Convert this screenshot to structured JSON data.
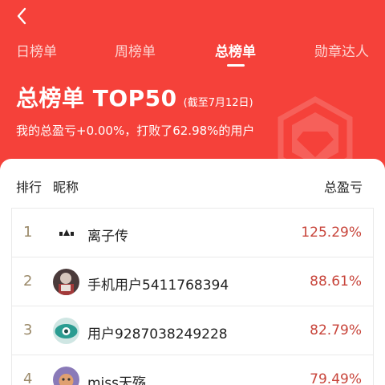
{
  "tabs": [
    {
      "label": "日榜单",
      "active": false
    },
    {
      "label": "周榜单",
      "active": false
    },
    {
      "label": "总榜单",
      "active": true
    },
    {
      "label": "勋章达人",
      "active": false
    }
  ],
  "board": {
    "title": "总榜单 TOP50",
    "as_of": "(截至7月12日)",
    "summary": "我的总盈亏+0.00%，打败了62.98%的用户"
  },
  "table": {
    "headers": {
      "rank": "排行",
      "nickname": "昵称",
      "profit": "总盈亏"
    },
    "rows": [
      {
        "rank": "1",
        "avatar": "logo-avatar",
        "nickname": "离子传",
        "profit": "125.29%"
      },
      {
        "rank": "2",
        "avatar": "photo-avatar",
        "nickname": "手机用户5411768394",
        "profit": "88.61%"
      },
      {
        "rank": "3",
        "avatar": "eye-avatar",
        "nickname": "用户9287038249228",
        "profit": "82.79%"
      },
      {
        "rank": "4",
        "avatar": "cartoon-avatar",
        "nickname": "miss天殇",
        "profit": "79.49%"
      }
    ]
  },
  "colors": {
    "header_bg": "#f5413a",
    "profit": "#c8453b",
    "rank": "#9b8a6a"
  }
}
